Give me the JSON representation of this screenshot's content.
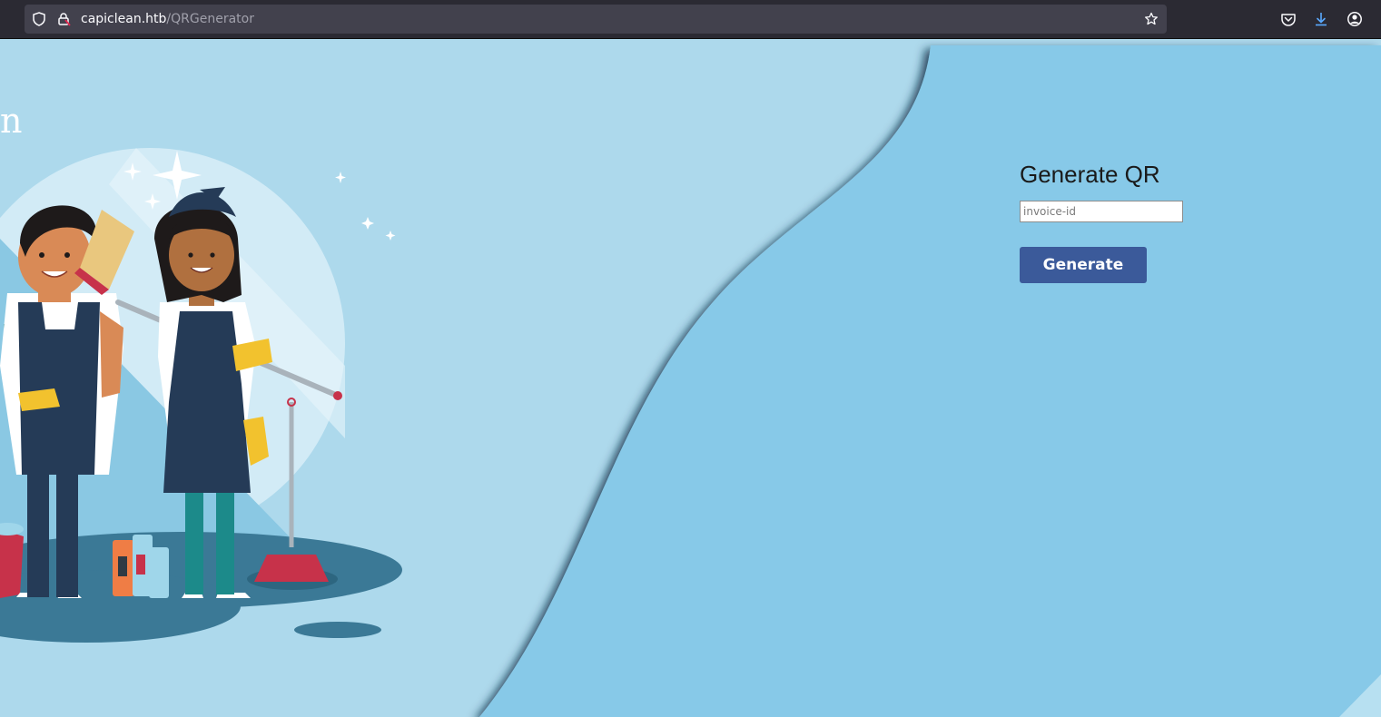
{
  "browser": {
    "url_host": "capiclean.htb",
    "url_path": "/QRGenerator",
    "icons": [
      "shield-icon",
      "lock-icon",
      "bookmark-star-icon",
      "pocket-icon",
      "download-icon",
      "account-icon"
    ]
  },
  "page": {
    "brand_fragment": "n",
    "form": {
      "title": "Generate QR",
      "input_placeholder": "invoice-id",
      "input_value": "",
      "button_label": "Generate"
    },
    "illustration": "cleaners-illustration"
  },
  "colors": {
    "page_light": "#add9ec",
    "panel_blue": "#87c9e8",
    "button": "#3b5a9a",
    "navy_overall": "#2b4a6b"
  }
}
